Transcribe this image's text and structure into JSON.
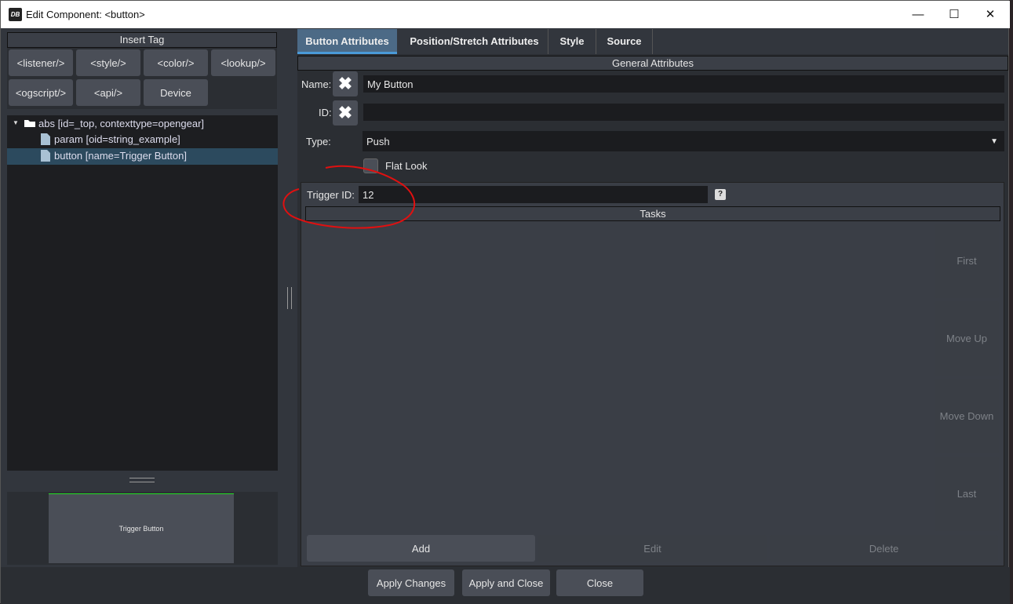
{
  "window": {
    "title": "Edit Component: <button>",
    "logo": "DB",
    "minimize": "—",
    "maximize": "☐",
    "close": "✕"
  },
  "left": {
    "insert_tag": "Insert Tag",
    "tag_buttons": [
      "<listener/>",
      "<style/>",
      "<color/>",
      "<lookup/>",
      "<ogscript/>",
      "<api/>",
      "Device"
    ],
    "tree": [
      {
        "label": "abs [id=_top, contexttype=opengear]",
        "icon": "folder-icon"
      },
      {
        "label": "param [oid=string_example]",
        "icon": "file-icon"
      },
      {
        "label": "button [name=Trigger Button]",
        "icon": "file-icon",
        "selected": true
      }
    ],
    "preview_button": "Trigger Button"
  },
  "tabs": [
    "Button Attributes",
    "Position/Stretch Attributes",
    "Style",
    "Source"
  ],
  "general": {
    "header": "General Attributes",
    "name_label": "Name:",
    "name_value": "My Button",
    "id_label": "ID:",
    "id_value": "",
    "type_label": "Type:",
    "type_value": "Push",
    "flat_look": "Flat Look",
    "flat_look_checked": false,
    "trigger_label": "Trigger ID:",
    "trigger_value": "12",
    "help": "?",
    "tasks_header": "Tasks",
    "side_buttons": [
      "First",
      "Move Up",
      "Move Down",
      "Last"
    ],
    "bottom_buttons": [
      "Add",
      "Edit",
      "Delete"
    ]
  },
  "footer": [
    "Apply Changes",
    "Apply and Close",
    "Close"
  ],
  "colors": {
    "accent": "#4a90c8",
    "selected": "#2c4a5e",
    "annotation": "#e01010",
    "preview_border": "#22dd22"
  }
}
